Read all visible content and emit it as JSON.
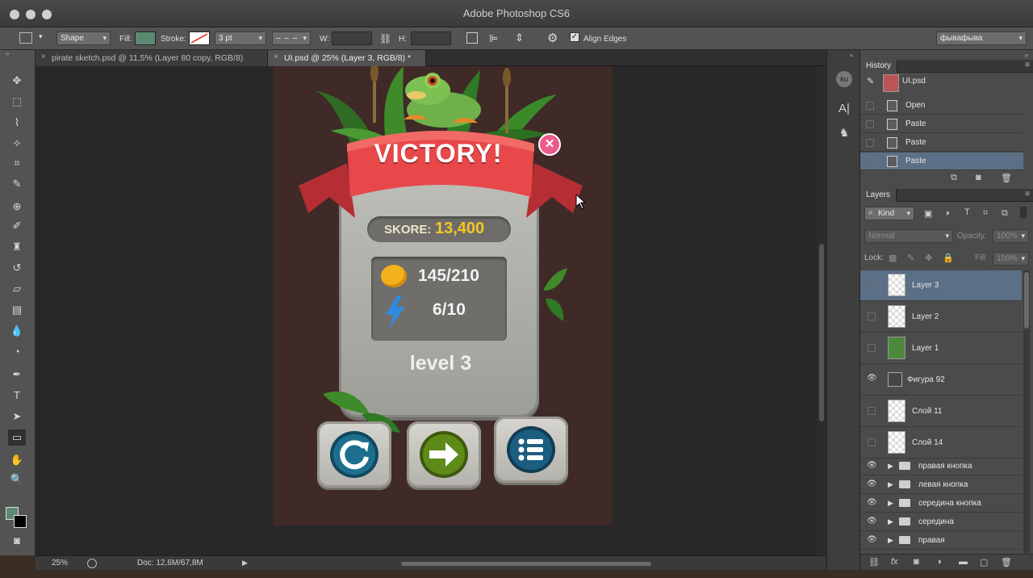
{
  "app": {
    "title": "Adobe Photoshop CS6"
  },
  "options": {
    "mode": "Shape",
    "fill_label": "Fill:",
    "fill_color": "#5c8a73",
    "stroke_label": "Stroke:",
    "stroke_width": "3 pt",
    "w_label": "W:",
    "h_label": "H:",
    "align_edges": "Align Edges",
    "align_edges_checked": true,
    "workspace": "фывафыва"
  },
  "tabs": [
    {
      "label": "pirate sketch.psd @ 11,5% (Layer 80 copy, RGB/8)",
      "active": false
    },
    {
      "label": "UI.psd @ 25% (Layer 3, RGB/8) *",
      "active": true
    }
  ],
  "canvas": {
    "title": "VICTORY!",
    "score_label": "SKORE:",
    "score_value": "13,400",
    "coins": "145/210",
    "energy": "6/10",
    "level": "level 3",
    "colors": {
      "background": "#3f2a27",
      "ribbon": "#e8484a",
      "score": "#f5c623",
      "close": "#ec5b8a"
    }
  },
  "status": {
    "zoom": "25%",
    "doc": "Doc: 12,6M/67,8M"
  },
  "history": {
    "tab": "History",
    "snapshot": "UI.psd",
    "items": [
      {
        "label": "Open",
        "selected": false
      },
      {
        "label": "Paste",
        "selected": false
      },
      {
        "label": "Paste",
        "selected": false
      },
      {
        "label": "Paste",
        "selected": true
      }
    ]
  },
  "layers": {
    "tab": "Layers",
    "filter": "Kind",
    "blend_mode": "Normal",
    "opacity_label": "Opacity:",
    "opacity_value": "100%",
    "lock_label": "Lock:",
    "fill_label": "Fill:",
    "fill_value": "100%",
    "items": [
      {
        "name": "Layer 3",
        "visible": false,
        "selected": true,
        "type": "layer"
      },
      {
        "name": "Layer 2",
        "visible": false,
        "selected": false,
        "type": "layer"
      },
      {
        "name": "Layer 1",
        "visible": false,
        "selected": false,
        "type": "layer"
      },
      {
        "name": "Фигура 92",
        "visible": true,
        "selected": false,
        "type": "shape"
      },
      {
        "name": "Слой 11",
        "visible": false,
        "selected": false,
        "type": "layer"
      },
      {
        "name": "Слой 14",
        "visible": false,
        "selected": false,
        "type": "layer"
      },
      {
        "name": "правая кнопка",
        "visible": true,
        "selected": false,
        "type": "group"
      },
      {
        "name": "левая кнопка",
        "visible": true,
        "selected": false,
        "type": "group"
      },
      {
        "name": "середина кнопка",
        "visible": true,
        "selected": false,
        "type": "group"
      },
      {
        "name": "середина",
        "visible": true,
        "selected": false,
        "type": "group"
      },
      {
        "name": "правая",
        "visible": true,
        "selected": false,
        "type": "group"
      }
    ]
  }
}
